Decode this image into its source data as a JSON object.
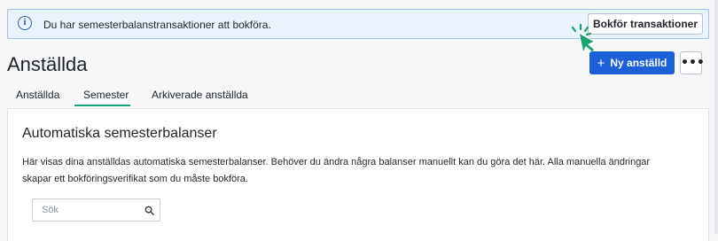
{
  "banner": {
    "icon": "info-icon",
    "icon_glyph": "i",
    "text": "Du har semesterbalanstransaktioner att bokföra.",
    "button_label": "Bokför transaktioner"
  },
  "page": {
    "title": "Anställda"
  },
  "actions": {
    "add_label": "Ny anställd",
    "add_icon": "plus-icon",
    "add_icon_glyph": "+",
    "more_icon": "more-icon",
    "more_glyph": "•••"
  },
  "tabs": [
    {
      "label": "Anställda",
      "active": false
    },
    {
      "label": "Semester",
      "active": true
    },
    {
      "label": "Arkiverade anställda",
      "active": false
    }
  ],
  "card": {
    "title": "Automatiska semesterbalanser",
    "description": "Här visas dina anställdas automatiska semesterbalanser. Behöver du ändra några balanser manuellt kan du göra det här. Alla manuella ändringar skapar ett bokföringsverifikat som du måste bokföra."
  },
  "search": {
    "placeholder": "Sök",
    "value": "",
    "icon": "search-icon"
  },
  "colors": {
    "primary": "#1d5fd6",
    "tab_active": "#12a679",
    "banner_bg": "#eaf2fb",
    "banner_border": "#9fc3ea",
    "click_mark": "#1aa36f"
  }
}
